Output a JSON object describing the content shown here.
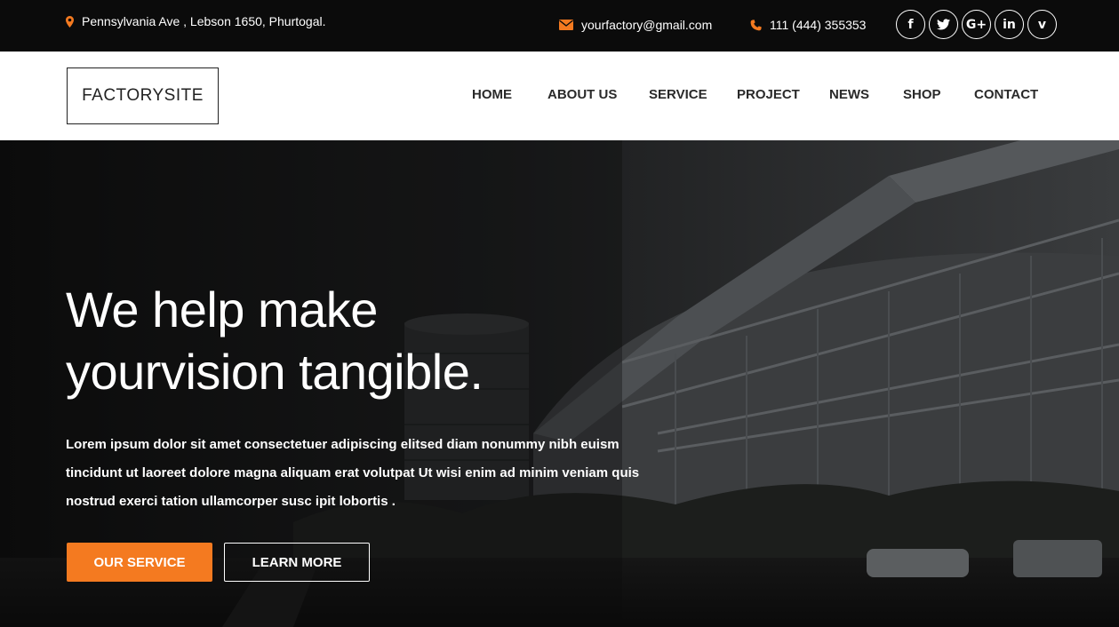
{
  "topbar": {
    "address": "Pennsylvania Ave , Lebson 1650, Phurtogal.",
    "email": "yourfactory@gmail.com",
    "phone": "111 (444) 355353",
    "socials": [
      {
        "name": "facebook",
        "glyph": "f"
      },
      {
        "name": "twitter",
        "glyph": "🐦"
      },
      {
        "name": "google-plus",
        "glyph": "G+"
      },
      {
        "name": "linkedin",
        "glyph": "in"
      },
      {
        "name": "vimeo",
        "glyph": "v"
      }
    ]
  },
  "header": {
    "logo": "FACTORYSITE",
    "nav": [
      "HOME",
      "ABOUT US",
      "SERVICE",
      "PROJECT",
      "NEWS",
      "SHOP",
      "CONTACT"
    ]
  },
  "hero": {
    "title_line1": "We help make",
    "title_line2": "yourvision tangible.",
    "text": "Lorem ipsum dolor sit amet consectetuer adipiscing elitsed diam nonummy nibh euism tincidunt ut laoreet dolore magna aliquam erat volutpat Ut wisi enim ad minim veniam quis nostrud exerci tation ullamcorper susc ipit lobortis .",
    "primary_button": "OUR SERVICE",
    "secondary_button": "LEARN MORE"
  },
  "colors": {
    "accent": "#f47a20",
    "topbar_bg": "#0b0b0b",
    "header_bg": "#ffffff"
  }
}
